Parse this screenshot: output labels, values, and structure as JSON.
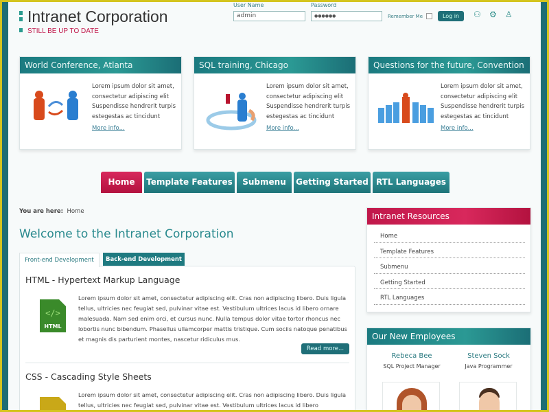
{
  "header": {
    "title": "Intranet Corporation",
    "tagline": "STILL BE UP TO DATE",
    "login": {
      "username_label": "User Name",
      "username_value": "admin",
      "password_label": "Password",
      "password_value": "●●●●●●",
      "remember_label": "Remember Me",
      "login_button": "Log in"
    },
    "icons": [
      "register-icon",
      "settings-user-icon",
      "add-user-icon"
    ]
  },
  "cards": [
    {
      "title": "World Conference, Atlanta",
      "text": "Lorem ipsum dolor sit amet, consectetur adipiscing elit Suspendisse hendrerit turpis estegestas ac tincidunt",
      "link": "More info..."
    },
    {
      "title": "SQL training, Chicago",
      "text": "Lorem ipsum dolor sit amet, consectetur adipiscing elit Suspendisse hendrerit turpis estegestas ac tincidunt",
      "link": "More info..."
    },
    {
      "title": "Questions for the future, Convention",
      "text": "Lorem ipsum dolor sit amet, consectetur adipiscing elit Suspendisse hendrerit turpis estegestas ac tincidunt",
      "link": "More info..."
    }
  ],
  "nav": [
    "Home",
    "Template Features",
    "Submenu",
    "Getting Started",
    "RTL Languages"
  ],
  "breadcrumb": {
    "label": "You are here:",
    "current": "Home"
  },
  "main": {
    "title": "Welcome to the Intranet Corporation",
    "tabs": [
      "Front-end Development",
      "Back-end Development"
    ],
    "articles": [
      {
        "title": "HTML - Hypertext Markup Language",
        "text": "Lorem ipsum dolor sit amet, consectetur adipiscing elit. Cras non adipiscing libero. Duis ligula tellus, ultricies nec feugiat sed, pulvinar vitae est. Vestibulum ultrices lacus id libero ornare malesuada. Nam sed enim orci, et cursus nunc. Nulla tempus dolor vitae tortor rhoncus nec lobortis nunc bibendum. Phasellus ullamcorper mattis tristique. Cum sociis natoque penatibus et magnis dis parturient montes, nascetur ridiculus mus.",
        "button": "Read more..."
      },
      {
        "title": "CSS - Cascading Style Sheets",
        "text": "Lorem ipsum dolor sit amet, consectetur adipiscing elit. Cras non adipiscing libero. Duis ligula tellus, ultricies nec feugiat sed, pulvinar vitae est. Vestibulum ultrices lacus id libero"
      }
    ]
  },
  "sidebar": {
    "resources_title": "Intranet Resources",
    "resources": [
      "Home",
      "Template Features",
      "Submenu",
      "Getting Started",
      "RTL Languages"
    ],
    "employees_title": "Our New Employees",
    "employees": [
      {
        "name": "Rebeca Bee",
        "role": "SQL Project Manager"
      },
      {
        "name": "Steven Sock",
        "role": "Java Programmer"
      }
    ]
  },
  "colors": {
    "teal": "#1f7a80",
    "red": "#c0184a"
  }
}
